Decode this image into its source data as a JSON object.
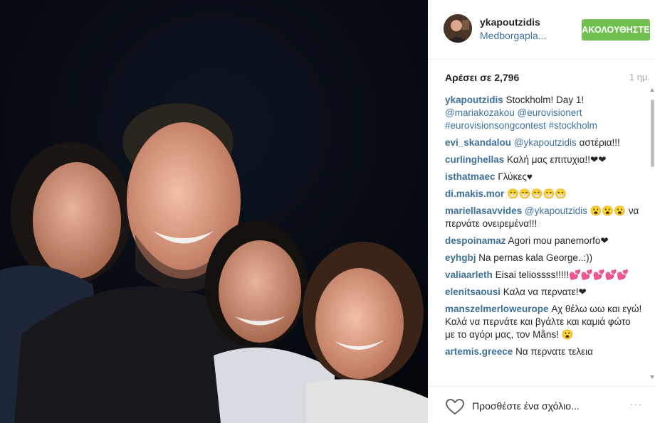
{
  "post": {
    "username": "ykapoutzidis",
    "location": "Medborgapla...",
    "follow_label": "ΑΚΟΛΟΥΘΗΣΤΕ",
    "likes": "Αρέσει σε 2,796",
    "time": "1 ημ."
  },
  "comments": [
    {
      "user": "ykapoutzidis",
      "text": "Stockholm! Day 1!",
      "links": "@mariakozakou @eurovisionert #eurovisionsongcontest #stockholm"
    },
    {
      "user": "evi_skandalou",
      "mention": "@ykapoutzidis",
      "text": "αστέρια!!!"
    },
    {
      "user": "curlinghellas",
      "text": "Καλή μας επιτυχια!!❤❤"
    },
    {
      "user": "isthatmaec",
      "text": "Γλύκες♥"
    },
    {
      "user": "di.makis.mor",
      "text": "😁😁😁😁😁"
    },
    {
      "user": "mariellasavvides",
      "mention": "@ykapoutzidis",
      "text": "😮😮😮 να περνάτε ονειρεμένα!!!"
    },
    {
      "user": "despoinamaz",
      "text": "Agori mou panemorfo❤"
    },
    {
      "user": "eyhgbj",
      "text": "Na pernas kala George..:))"
    },
    {
      "user": "valiaarleth",
      "text": "Eisai teliossss!!!!!💕💕💕💕💕"
    },
    {
      "user": "elenitsaousi",
      "text": "Καλα να περνατε!❤"
    },
    {
      "user": "manszelmerloweurope",
      "text": "Αχ θέλω ωω και εγώ! Καλά να περνάτε και βγάλτε και καμιά φώτο με το αγόρι μας, τον Måns! 😮"
    },
    {
      "user": "artemis.greece",
      "text": "Να περνατε τελεια"
    }
  ],
  "footer": {
    "comment_placeholder": "Προσθέστε ένα σχόλιο...",
    "more_label": "···"
  },
  "colors": {
    "follow_button": "#70c050",
    "link": "#3f729b",
    "photo_background": "#070b12"
  },
  "icons": {
    "like": "heart-outline-icon",
    "more": "ellipsis-icon"
  }
}
